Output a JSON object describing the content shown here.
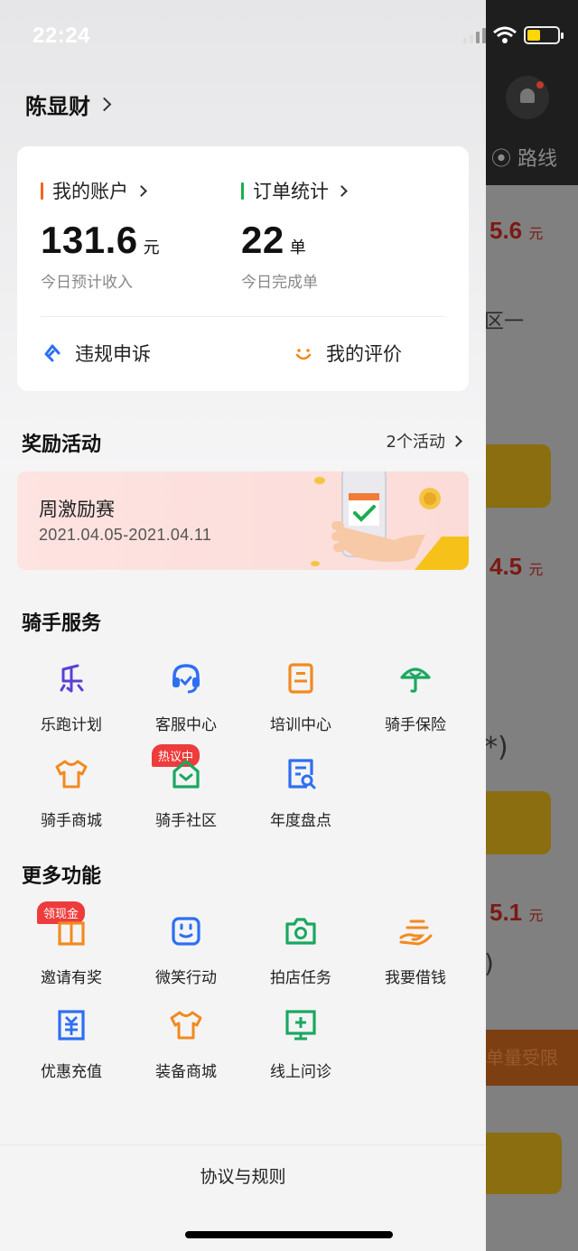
{
  "status_bar": {
    "time": "22:24"
  },
  "background": {
    "route_label": "路线",
    "prices": [
      {
        "value": "5.6",
        "unit": "元"
      },
      {
        "value": "4.5",
        "unit": "元"
      },
      {
        "value": "5.1",
        "unit": "元"
      }
    ],
    "fragments": [
      "区一",
      "*)",
      ")"
    ],
    "limit_text": "单量受限"
  },
  "drawer": {
    "user_name": "陈显财",
    "account": {
      "title": "我的账户",
      "value": "131.6",
      "unit": "元",
      "sub": "今日预计收入",
      "accent": "#f26522"
    },
    "orders": {
      "title": "订单统计",
      "value": "22",
      "unit": "单",
      "sub": "今日完成单",
      "accent": "#1aad4e"
    },
    "quick_actions": [
      {
        "label": "违规申诉",
        "icon": "appeal-icon",
        "color": "#2d6ff2"
      },
      {
        "label": "我的评价",
        "icon": "smile-icon",
        "color": "#f28a1e"
      }
    ],
    "rewards": {
      "title": "奖励活动",
      "more": "2个活动",
      "banner": {
        "title": "周激励赛",
        "date": "2021.04.05-2021.04.11"
      }
    },
    "rider_services": {
      "title": "骑手服务",
      "items": [
        {
          "label": "乐跑计划",
          "icon": "le-icon",
          "color": "#5b3fd6"
        },
        {
          "label": "客服中心",
          "icon": "headset-icon",
          "color": "#2d6ff2"
        },
        {
          "label": "培训中心",
          "icon": "training-icon",
          "color": "#f28a1e"
        },
        {
          "label": "骑手保险",
          "icon": "umbrella-icon",
          "color": "#1aa860"
        },
        {
          "label": "骑手商城",
          "icon": "tshirt-icon",
          "color": "#f28a1e"
        },
        {
          "label": "骑手社区",
          "icon": "community-icon",
          "color": "#1aa860",
          "badge": "热议中"
        },
        {
          "label": "年度盘点",
          "icon": "report-icon",
          "color": "#2d6ff2"
        }
      ]
    },
    "more_features": {
      "title": "更多功能",
      "items": [
        {
          "label": "邀请有奖",
          "icon": "gift-icon",
          "color": "#f28a1e",
          "badge": "领现金"
        },
        {
          "label": "微笑行动",
          "icon": "face-icon",
          "color": "#2d6ff2"
        },
        {
          "label": "拍店任务",
          "icon": "camera-icon",
          "color": "#1aa860"
        },
        {
          "label": "我要借钱",
          "icon": "loan-icon",
          "color": "#f28a1e"
        },
        {
          "label": "优惠充值",
          "icon": "yen-icon",
          "color": "#2d6ff2"
        },
        {
          "label": "装备商城",
          "icon": "equipment-icon",
          "color": "#f28a1e"
        },
        {
          "label": "线上问诊",
          "icon": "consult-icon",
          "color": "#1aa860"
        }
      ]
    },
    "footer_link": "协议与规则"
  }
}
